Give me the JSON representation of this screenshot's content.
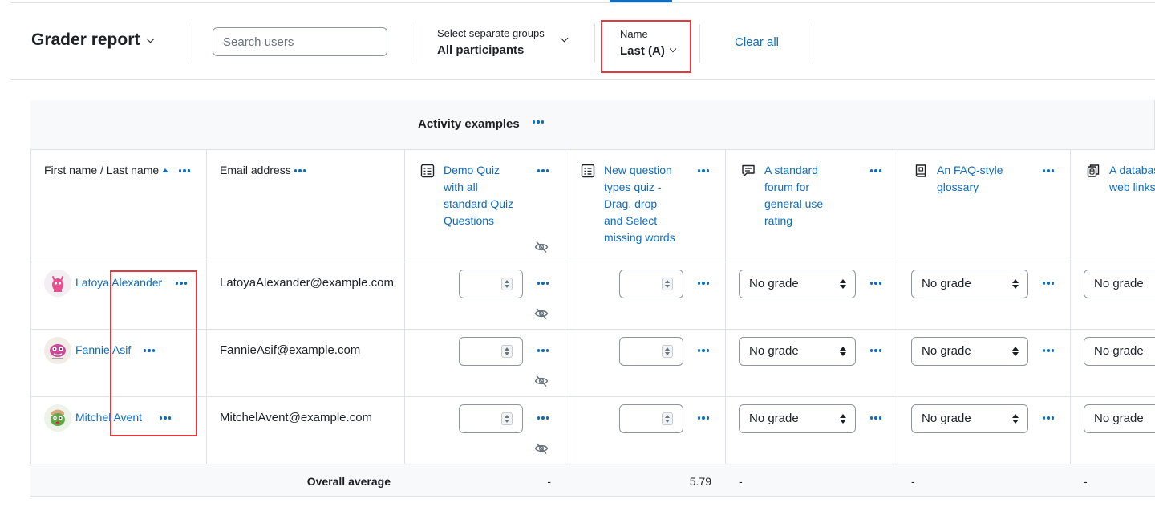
{
  "header": {
    "title": "Grader report",
    "search_placeholder": "Search users",
    "groups": {
      "label": "Select separate groups",
      "value": "All participants"
    },
    "name_filter": {
      "label": "Name",
      "value": "Last (A)"
    },
    "clear_all": "Clear all"
  },
  "table": {
    "category": "Activity examples",
    "columns": {
      "name": "First name / Last name",
      "email": "Email address"
    },
    "activities": [
      {
        "name": "Demo Quiz with all standard Quiz Questions",
        "lines": [
          "Demo Quiz",
          "with all",
          "standard Quiz",
          "Questions"
        ],
        "icon": "quiz-icon",
        "hidden": true
      },
      {
        "name": "New question types quiz - Drag, drop and Select missing words",
        "lines": [
          "New question",
          "types quiz -",
          "Drag, drop",
          "and Select",
          "missing words"
        ],
        "icon": "quiz-icon",
        "hidden": false
      },
      {
        "name": "A standard forum for general use rating",
        "lines": [
          "A standard",
          "forum for",
          "general use",
          "rating"
        ],
        "icon": "forum-icon",
        "hidden": false
      },
      {
        "name": "An FAQ-style glossary",
        "lines": [
          "An FAQ-style",
          "glossary"
        ],
        "icon": "glossary-icon",
        "hidden": false
      },
      {
        "name": "A database web links",
        "lines": [
          "A databas",
          "web links"
        ],
        "icon": "database-icon",
        "hidden": false
      }
    ],
    "rows": [
      {
        "name": "Latoya Alexander",
        "email": "LatoyaAlexander@example.com",
        "avatar_color": "#e8508f",
        "grades": [
          "",
          "",
          "No grade",
          "No grade",
          "No grade"
        ]
      },
      {
        "name": "Fannie Asif",
        "email": "FannieAsif@example.com",
        "avatar_color": "#c94a9b",
        "grades": [
          "",
          "",
          "No grade",
          "No grade",
          "No grade"
        ]
      },
      {
        "name": "Mitchel Avent",
        "email": "MitchelAvent@example.com",
        "avatar_color": "#5fa84a",
        "grades": [
          "",
          "",
          "No grade",
          "No grade",
          "No grade"
        ]
      }
    ],
    "overall": {
      "label": "Overall average",
      "values": [
        "-",
        "5.79",
        "-",
        "-",
        "-"
      ]
    }
  },
  "colors": {
    "link": "#0f6cbf",
    "annotation": "#e0393e",
    "border": "#dee2e6"
  }
}
